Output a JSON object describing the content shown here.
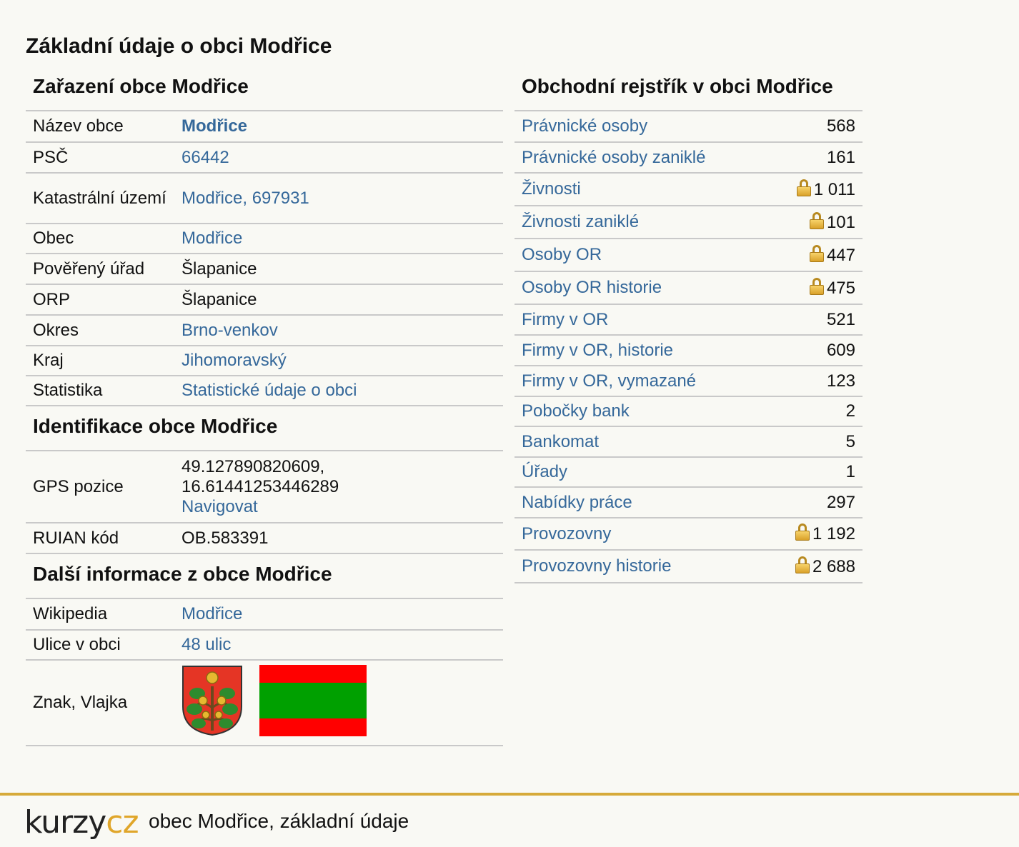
{
  "page_title": "Základní údaje o obci Modřice",
  "zarazeni": {
    "title": "Zařazení obce Modřice",
    "rows": [
      {
        "label": "Název obce",
        "value": "Modřice"
      },
      {
        "label": "PSČ",
        "value": "66442"
      },
      {
        "label": "Katastrální území",
        "value": "Modřice, 697931"
      },
      {
        "label": "Obec",
        "value": "Modřice"
      },
      {
        "label": "Pověřený úřad",
        "value": "Šlapanice"
      },
      {
        "label": "ORP",
        "value": "Šlapanice"
      },
      {
        "label": "Okres",
        "value": "Brno-venkov"
      },
      {
        "label": "Kraj",
        "value": "Jihomoravský"
      },
      {
        "label": "Statistika",
        "value": "Statistické údaje o obci"
      }
    ]
  },
  "identifikace": {
    "title": "Identifikace obce Modřice",
    "gps_label": "GPS pozice",
    "gps_value": "49.127890820609, 16.61441253446289",
    "gps_link": "Navigovat",
    "ruian_label": "RUIAN kód",
    "ruian_value": "OB.583391"
  },
  "dalsi": {
    "title": "Další informace z obce Modřice",
    "wiki_label": "Wikipedia",
    "wiki_value": "Modřice",
    "ulice_label": "Ulice v obci",
    "ulice_value": "48 ulic",
    "znak_label": "Znak, Vlajka",
    "flag_colors": [
      "#ff0000",
      "#00a000",
      "#ff0000"
    ],
    "coat_icon": "oak-branch-coat-of-arms"
  },
  "rejstrik": {
    "title": "Obchodní rejstřík v obci Modřice",
    "rows": [
      {
        "label": "Právnické osoby",
        "value": "568",
        "locked": false
      },
      {
        "label": "Právnické osoby zaniklé",
        "value": "161",
        "locked": false
      },
      {
        "label": "Živnosti",
        "value": "1 011",
        "locked": true
      },
      {
        "label": "Živnosti zaniklé",
        "value": "101",
        "locked": true
      },
      {
        "label": "Osoby OR",
        "value": "447",
        "locked": true
      },
      {
        "label": "Osoby OR historie",
        "value": "475",
        "locked": true
      },
      {
        "label": "Firmy v OR",
        "value": "521",
        "locked": false
      },
      {
        "label": "Firmy v OR, historie",
        "value": "609",
        "locked": false
      },
      {
        "label": "Firmy v OR, vymazané",
        "value": "123",
        "locked": false
      },
      {
        "label": "Pobočky bank",
        "value": "2",
        "locked": false
      },
      {
        "label": "Bankomat",
        "value": "5",
        "locked": false
      },
      {
        "label": "Úřady",
        "value": "1",
        "locked": false
      },
      {
        "label": "Nabídky práce",
        "value": "297",
        "locked": false
      },
      {
        "label": "Provozovny",
        "value": "1 192",
        "locked": true
      },
      {
        "label": "Provozovny historie",
        "value": "2 688",
        "locked": true
      }
    ]
  },
  "footer": {
    "logo_part1": "kurzy",
    "logo_part2": "cz",
    "text": "obec Modřice, základní údaje"
  },
  "colors": {
    "link": "#35689a",
    "accent": "#d6aa3a",
    "background": "#f9f9f4"
  }
}
